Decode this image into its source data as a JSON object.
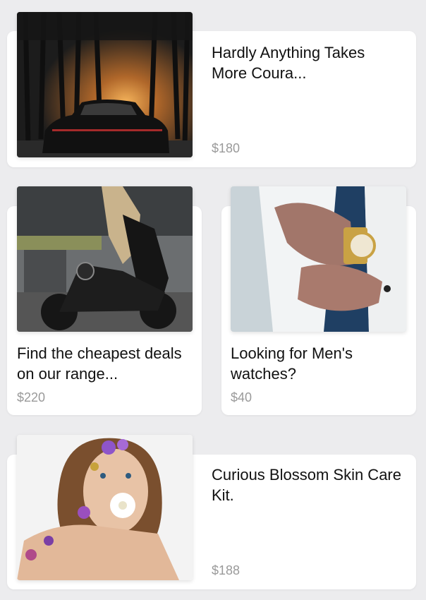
{
  "products": [
    {
      "title": "Hardly Anything Takes More Coura...",
      "price": "$180",
      "image": "sports-car-sunset-photo"
    },
    {
      "title": "Find the cheapest deals on our range...",
      "price": "$220",
      "image": "woman-on-motorcycle-photo"
    },
    {
      "title": "Looking for Men's watches?",
      "price": "$40",
      "image": "mens-gold-watch-photo"
    },
    {
      "title": "Curious Blossom Skin Care Kit.",
      "price": "$188",
      "image": "woman-with-flowers-photo"
    }
  ]
}
